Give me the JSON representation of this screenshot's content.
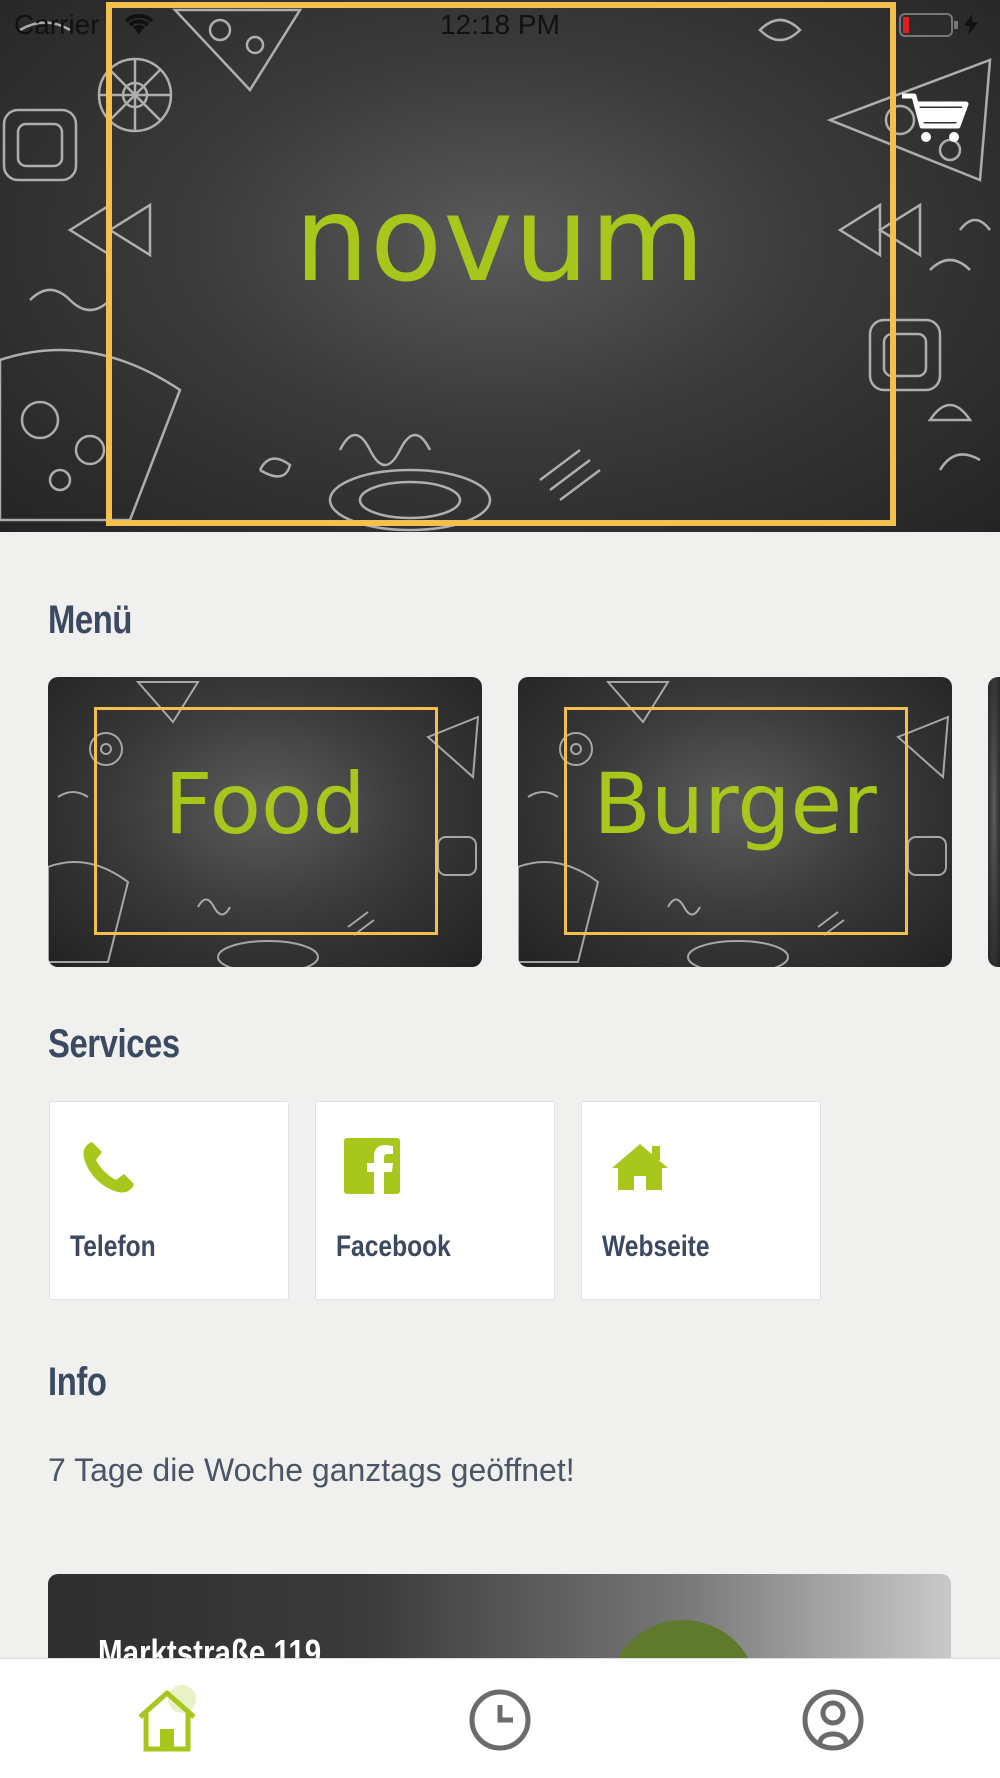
{
  "status_bar": {
    "carrier": "Carrier",
    "time": "12:18 PM"
  },
  "hero": {
    "title": "novum",
    "frame_color": "#f3c04f",
    "title_color": "#a8c71c"
  },
  "cart": {
    "icon": "cart-icon"
  },
  "menu": {
    "title": "Menü",
    "cards": [
      {
        "label": "Food"
      },
      {
        "label": "Burger"
      }
    ]
  },
  "services": {
    "title": "Services",
    "items": [
      {
        "label": "Telefon",
        "icon": "phone-icon"
      },
      {
        "label": "Facebook",
        "icon": "facebook-icon"
      },
      {
        "label": "Webseite",
        "icon": "home-icon"
      }
    ]
  },
  "info": {
    "title": "Info",
    "text": "7 Tage die Woche ganztags geöffnet!"
  },
  "address": {
    "street": "Marktstraße 119"
  },
  "tab_bar": {
    "tabs": [
      {
        "icon": "home-icon",
        "active": true
      },
      {
        "icon": "history-icon",
        "active": false
      },
      {
        "icon": "profile-icon",
        "active": false
      }
    ],
    "accent": "#a8c71c",
    "inactive": "#6b6b6b"
  }
}
